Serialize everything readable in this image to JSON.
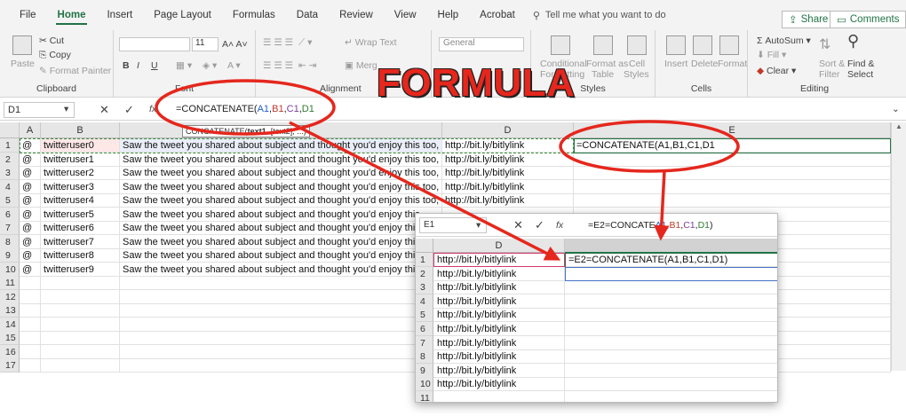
{
  "ribbon": {
    "tabs": [
      "File",
      "Home",
      "Insert",
      "Page Layout",
      "Formulas",
      "Data",
      "Review",
      "View",
      "Help",
      "Acrobat"
    ],
    "tell_me": "Tell me what you want to do",
    "share": "Share",
    "comments": "Comments",
    "clipboard": {
      "paste": "Paste",
      "cut": "Cut",
      "copy": "Copy",
      "format_painter": "Format Painter",
      "label": "Clipboard"
    },
    "font": {
      "size": "11",
      "label": "Font",
      "bold": "B",
      "italic": "I",
      "underline": "U"
    },
    "alignment": {
      "wrap_text": "Wrap Text",
      "merge": "Merg",
      "label": "Alignment"
    },
    "number": {
      "format": "General"
    },
    "styles": {
      "conditional": "Conditional",
      "formatting": "Formatting",
      "format_as": "Format as",
      "table": "Table",
      "cell": "Cell",
      "styles_word": "Styles",
      "label": "Styles"
    },
    "cells": {
      "insert": "Insert",
      "delete": "Delete",
      "format": "Format",
      "label": "Cells"
    },
    "editing": {
      "autosum": "AutoSum",
      "fill": "Fill",
      "clear": "Clear",
      "sort": "Sort &",
      "filter": "Filter",
      "find": "Find &",
      "select": "Select",
      "label": "Editing"
    }
  },
  "formula_bar": {
    "name_box": "D1",
    "fx": "fx",
    "formula_prefix": "=CONCATENATE(",
    "args": [
      "A1",
      "B1",
      "C1",
      "D1"
    ]
  },
  "tooltip": {
    "func": "CONCATENATE(",
    "arg1": "text1",
    "rest": ", [text2], ...)"
  },
  "columns": [
    "A",
    "B",
    "C",
    "D",
    "E"
  ],
  "rows": [
    {
      "n": "1",
      "a": "@",
      "b": "twitteruser0",
      "c": "Saw the tweet you shared about subject and thought you'd enjoy this too,",
      "d": "http://bit.ly/bitlylink",
      "e": "=CONCATENATE(A1,B1,C1,D1"
    },
    {
      "n": "2",
      "a": "@",
      "b": "twitteruser1",
      "c": "Saw the tweet you shared about subject and thought you'd enjoy this too,",
      "d": "http://bit.ly/bitlylink",
      "e": ""
    },
    {
      "n": "3",
      "a": "@",
      "b": "twitteruser2",
      "c": "Saw the tweet you shared about subject and thought you'd enjoy this too,",
      "d": "http://bit.ly/bitlylink",
      "e": ""
    },
    {
      "n": "4",
      "a": "@",
      "b": "twitteruser3",
      "c": "Saw the tweet you shared about subject and thought you'd enjoy this too,",
      "d": "http://bit.ly/bitlylink",
      "e": ""
    },
    {
      "n": "5",
      "a": "@",
      "b": "twitteruser4",
      "c": "Saw the tweet you shared about subject and thought you'd enjoy this too,",
      "d": "http://bit.ly/bitlylink",
      "e": ""
    },
    {
      "n": "6",
      "a": "@",
      "b": "twitteruser5",
      "c": "Saw the tweet you shared about subject and thought you'd enjoy this",
      "d": "",
      "e": ""
    },
    {
      "n": "7",
      "a": "@",
      "b": "twitteruser6",
      "c": "Saw the tweet you shared about subject and thought you'd enjoy this",
      "d": "",
      "e": ""
    },
    {
      "n": "8",
      "a": "@",
      "b": "twitteruser7",
      "c": "Saw the tweet you shared about subject and thought you'd enjoy this",
      "d": "",
      "e": ""
    },
    {
      "n": "9",
      "a": "@",
      "b": "twitteruser8",
      "c": "Saw the tweet you shared about subject and thought you'd enjoy this",
      "d": "",
      "e": ""
    },
    {
      "n": "10",
      "a": "@",
      "b": "twitteruser9",
      "c": "Saw the tweet you shared about subject and thought you'd enjoy this",
      "d": "",
      "e": ""
    },
    {
      "n": "11",
      "a": "",
      "b": "",
      "c": "",
      "d": "",
      "e": ""
    },
    {
      "n": "12",
      "a": "",
      "b": "",
      "c": "",
      "d": "",
      "e": ""
    },
    {
      "n": "13",
      "a": "",
      "b": "",
      "c": "",
      "d": "",
      "e": ""
    },
    {
      "n": "14",
      "a": "",
      "b": "",
      "c": "",
      "d": "",
      "e": ""
    },
    {
      "n": "15",
      "a": "",
      "b": "",
      "c": "",
      "d": "",
      "e": ""
    },
    {
      "n": "16",
      "a": "",
      "b": "",
      "c": "",
      "d": "",
      "e": ""
    },
    {
      "n": "17",
      "a": "",
      "b": "",
      "c": "",
      "d": "",
      "e": ""
    }
  ],
  "inset": {
    "name_box": "E1",
    "fx": "fx",
    "formula_prefix": "=E2=CONCATE",
    "formula_args": [
      "B1",
      "C1",
      "D1"
    ],
    "formula_arg_tail": "A1,",
    "col_header": "D",
    "rows": [
      {
        "n": "1",
        "d": "http://bit.ly/bitlylink",
        "e": "=E2=CONCATENATE(A1,B1,C1,D1)"
      },
      {
        "n": "2",
        "d": "http://bit.ly/bitlylink",
        "e": ""
      },
      {
        "n": "3",
        "d": "http://bit.ly/bitlylink",
        "e": ""
      },
      {
        "n": "4",
        "d": "http://bit.ly/bitlylink",
        "e": ""
      },
      {
        "n": "5",
        "d": "http://bit.ly/bitlylink",
        "e": ""
      },
      {
        "n": "6",
        "d": "http://bit.ly/bitlylink",
        "e": ""
      },
      {
        "n": "7",
        "d": "http://bit.ly/bitlylink",
        "e": ""
      },
      {
        "n": "8",
        "d": "http://bit.ly/bitlylink",
        "e": ""
      },
      {
        "n": "9",
        "d": "http://bit.ly/bitlylink",
        "e": ""
      },
      {
        "n": "10",
        "d": "http://bit.ly/bitlylink",
        "e": ""
      },
      {
        "n": "11",
        "d": "",
        "e": ""
      }
    ]
  },
  "annotation_title": "FORMULA",
  "colors": {
    "accent": "#217346",
    "annotation": "#e5271d"
  }
}
